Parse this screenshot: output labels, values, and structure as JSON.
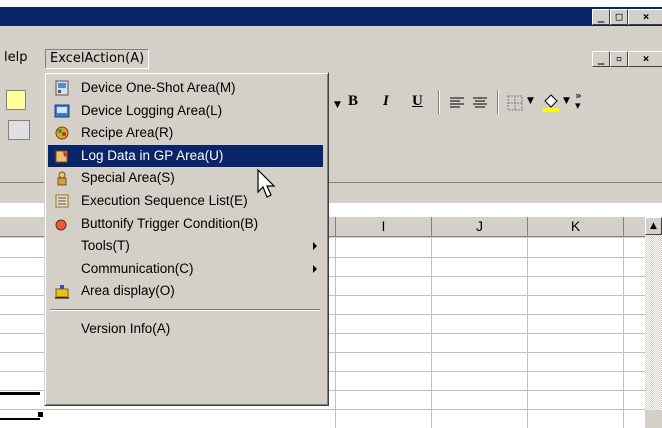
{
  "menubar": {
    "help_partial": "lelp",
    "excel_action": "ExcelAction(A)"
  },
  "toolbar": {
    "bold": "B",
    "italic": "I",
    "underline": "U"
  },
  "columns": [
    "I",
    "J",
    "K"
  ],
  "dropdown": {
    "items": [
      {
        "label": "Device One-Shot Area(M)",
        "icon": "device-oneshot-icon"
      },
      {
        "label": "Device Logging Area(L)",
        "icon": "device-logging-icon"
      },
      {
        "label": "Recipe Area(R)",
        "icon": "recipe-icon"
      },
      {
        "label": "Log Data in GP Area(U)",
        "icon": "log-data-icon",
        "selected": true
      },
      {
        "label": "Special Area(S)",
        "icon": "special-area-icon"
      },
      {
        "label": "Execution Sequence List(E)",
        "icon": "execution-list-icon"
      },
      {
        "label": "Buttonify Trigger Condition(B)",
        "icon": "buttonify-icon"
      },
      {
        "label": "Tools(T)",
        "submenu": true
      },
      {
        "label": "Communication(C)",
        "submenu": true
      },
      {
        "label": "Area display(O)",
        "icon": "area-display-icon"
      },
      {
        "label": "Version Info(A)"
      }
    ]
  },
  "colors": {
    "title_bar": "#0a246a",
    "face": "#d4d0c8",
    "highlight": "#0a246a"
  }
}
